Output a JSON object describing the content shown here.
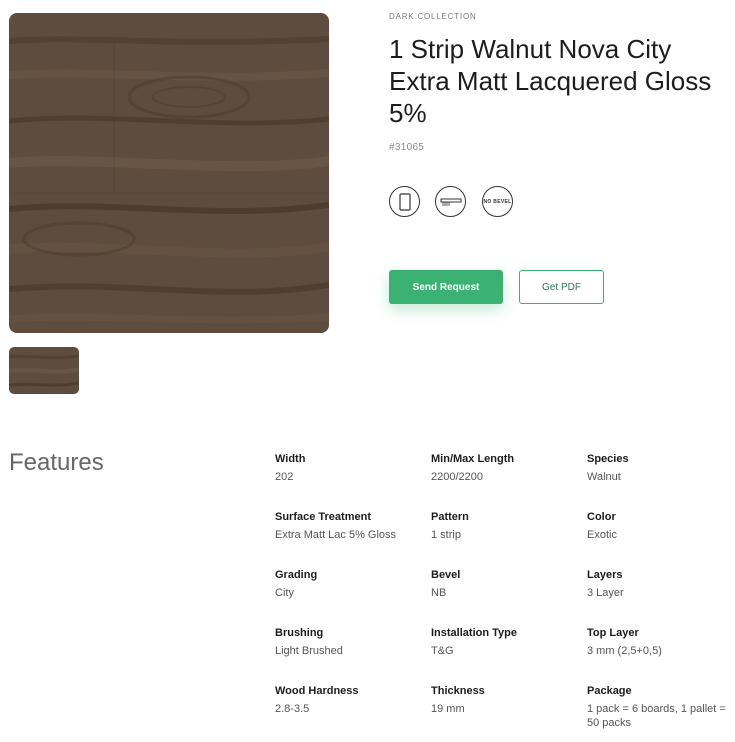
{
  "product": {
    "collection": "DARK COLLECTION",
    "title": "1 Strip Walnut Nova City Extra Matt Lacquered Gloss 5%",
    "sku": "#31065",
    "bevel_icon_text": "NO BEVEL"
  },
  "actions": {
    "send_request": "Send Request",
    "get_pdf": "Get PDF"
  },
  "features": {
    "heading": "Features",
    "items": [
      {
        "label": "Width",
        "value": "202"
      },
      {
        "label": "Min/Max Length",
        "value": "2200/2200"
      },
      {
        "label": "Species",
        "value": "Walnut"
      },
      {
        "label": "Surface Treatment",
        "value": "Extra Matt Lac 5% Gloss"
      },
      {
        "label": "Pattern",
        "value": "1 strip"
      },
      {
        "label": "Color",
        "value": "Exotic"
      },
      {
        "label": "Grading",
        "value": "City"
      },
      {
        "label": "Bevel",
        "value": "NB"
      },
      {
        "label": "Layers",
        "value": "3 Layer"
      },
      {
        "label": "Brushing",
        "value": "Light Brushed"
      },
      {
        "label": "Installation Type",
        "value": "T&G"
      },
      {
        "label": "Top Layer",
        "value": "3 mm (2,5+0,5)"
      },
      {
        "label": "Wood Hardness",
        "value": "2.8-3.5"
      },
      {
        "label": "Thickness",
        "value": "19 mm"
      },
      {
        "label": "Package",
        "value": "1 pack = 6 boards, 1 pallet = 50 packs"
      }
    ]
  },
  "icons": [
    "plank-icon",
    "click-system-icon",
    "no-bevel-icon"
  ],
  "colors": {
    "accent": "#3bb273",
    "wood_base": "#5e4c3e"
  }
}
